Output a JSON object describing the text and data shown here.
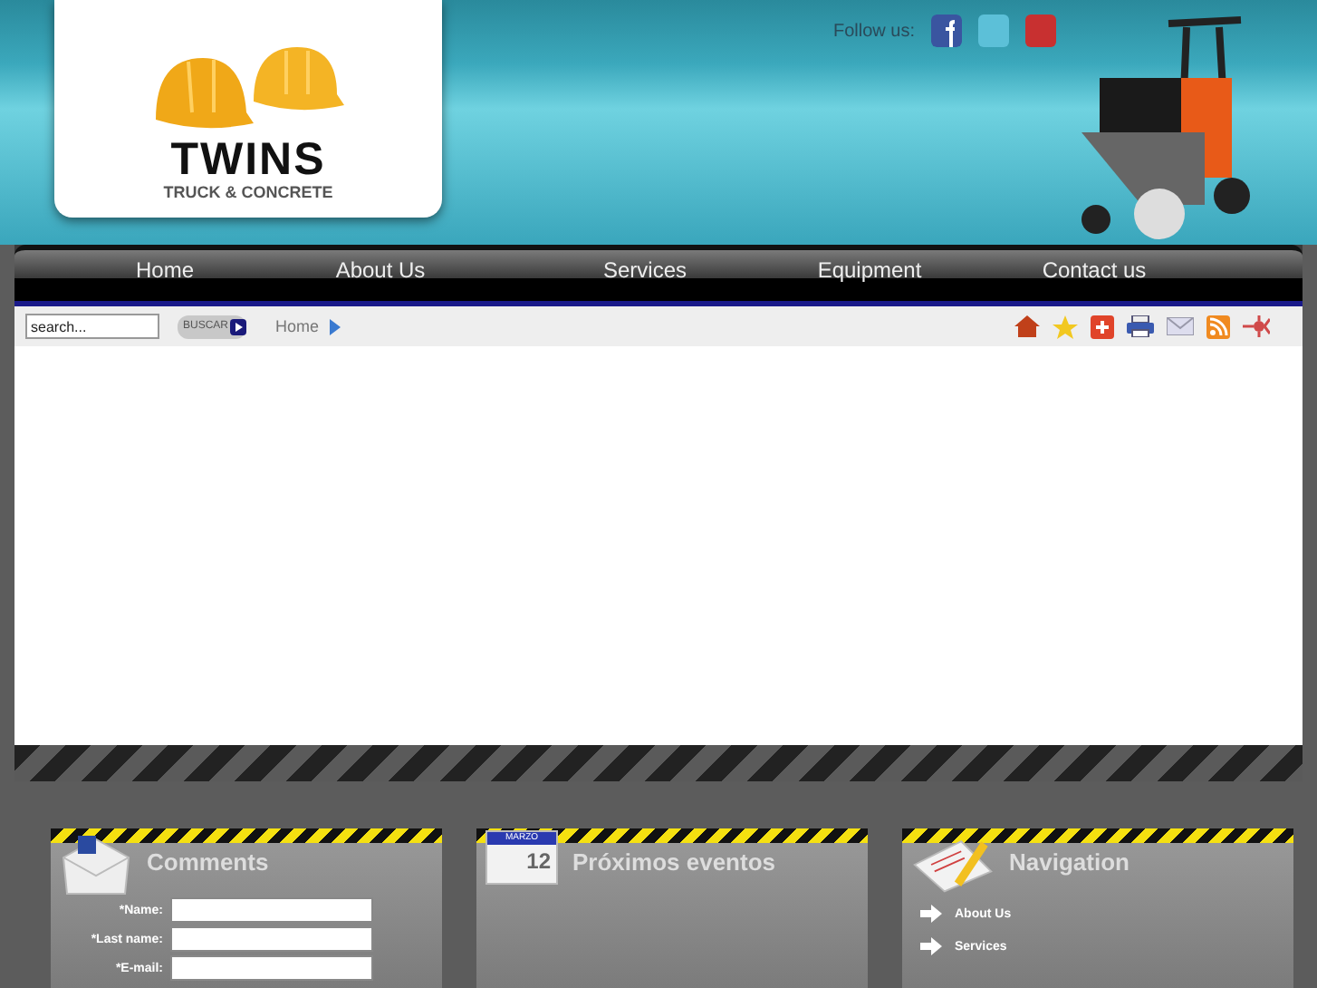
{
  "logo": {
    "name": "TWINS",
    "tagline": "TRUCK & CONCRETE"
  },
  "social": {
    "label": "Follow us:"
  },
  "nav": [
    {
      "label": "Home",
      "selected": false
    },
    {
      "label": "About Us",
      "selected": false
    },
    {
      "label": "Services",
      "selected": false
    },
    {
      "label": "Equipment",
      "selected": false
    },
    {
      "label": "Contact us",
      "selected": false
    }
  ],
  "toolbar": {
    "search": {
      "placeholder": "search..."
    },
    "search_button": "BUSCAR",
    "breadcrumb": "Home"
  },
  "panels": [
    {
      "kind": "form",
      "title": "Comments",
      "fields": [
        {
          "label": "*Name:"
        },
        {
          "label": "*Last name:"
        },
        {
          "label": "*E-mail:"
        }
      ]
    },
    {
      "kind": "events",
      "title": "Próximos eventos",
      "calendar": {
        "month": "MARZO",
        "day": "12"
      }
    },
    {
      "kind": "links",
      "title": "Navigation",
      "links": [
        "About Us",
        "Services"
      ]
    }
  ]
}
